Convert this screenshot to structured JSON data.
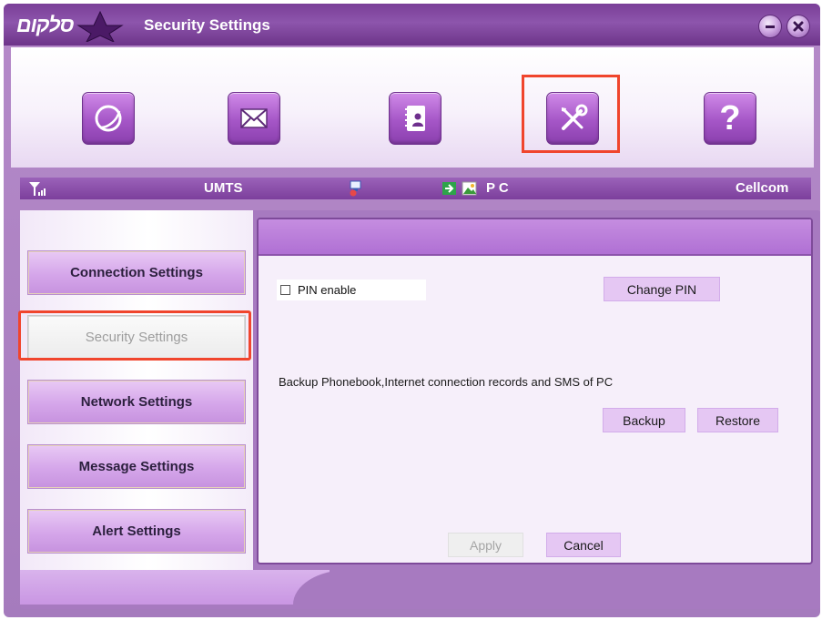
{
  "window": {
    "logo_text": "סלקום",
    "title": "Security Settings",
    "minimize_icon": "minimize-icon",
    "close_icon": "close-icon"
  },
  "toolbar": {
    "items": [
      {
        "name": "internet",
        "icon": "globe-icon"
      },
      {
        "name": "messages",
        "icon": "envelope-icon"
      },
      {
        "name": "phonebook",
        "icon": "contacts-book-icon"
      },
      {
        "name": "settings",
        "icon": "tools-icon",
        "selected": true
      },
      {
        "name": "help",
        "icon": "question-icon"
      }
    ]
  },
  "status": {
    "signal_icon": "signal-strength-icon",
    "network": "UMTS",
    "connection_icon": "network-status-icon",
    "storage_icons": [
      "sim-icon",
      "photo-icon"
    ],
    "location": "P C",
    "operator": "Cellcom"
  },
  "nav": {
    "items": [
      {
        "label": "Connection Settings"
      },
      {
        "label": "Security Settings",
        "active": true
      },
      {
        "label": "Network Settings"
      },
      {
        "label": "Message Settings"
      },
      {
        "label": "Alert Settings"
      }
    ]
  },
  "security": {
    "pin_enable_label": "PIN enable",
    "pin_enabled": false,
    "change_pin_label": "Change PIN",
    "backup_text": "Backup Phonebook,Internet connection records and SMS of PC",
    "backup_label": "Backup",
    "restore_label": "Restore",
    "apply_label": "Apply",
    "apply_enabled": false,
    "cancel_label": "Cancel"
  },
  "colors": {
    "accent_purple": "#8d55ac",
    "highlight_red": "#f0452d"
  }
}
